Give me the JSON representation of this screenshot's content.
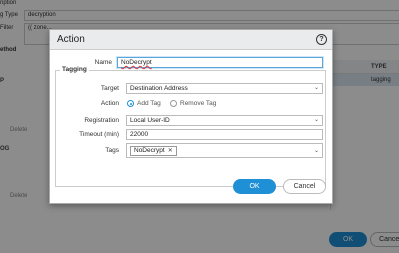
{
  "background": {
    "rows": [
      {
        "label": "ription"
      },
      {
        "label": "g Type",
        "value": "decryption"
      },
      {
        "label": "Filter",
        "value": "(( zone..."
      },
      {
        "label": "ethod"
      }
    ],
    "table_header": "TYPE",
    "table_row": "tagging",
    "section_p": "P",
    "section_og": "OG",
    "delete_label": "Delete",
    "ok_label": "OK",
    "cancel_label": "Cancel"
  },
  "dialog": {
    "title": "Action",
    "help_icon": "?",
    "name_label": "Name",
    "name_value": "NoDecrypt",
    "tagging_legend": "Tagging",
    "target_label": "Target",
    "target_value": "Destination Address",
    "action_label": "Action",
    "action_options": [
      "Add Tag",
      "Remove Tag"
    ],
    "action_selected": "Add Tag",
    "registration_label": "Registration",
    "registration_value": "Local User-ID",
    "timeout_label": "Timeout (min)",
    "timeout_value": "22000",
    "tags_label": "Tags",
    "tags": [
      "NoDecrypt"
    ],
    "ok_label": "OK",
    "cancel_label": "Cancel"
  },
  "colors": {
    "accent": "#1f8fd6"
  }
}
